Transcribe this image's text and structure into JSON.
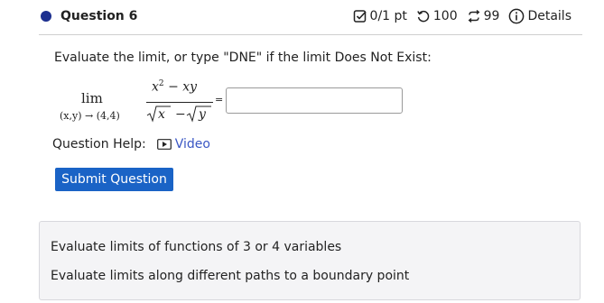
{
  "question": {
    "title": "Question 6",
    "score": "0/1 pt",
    "retries": "100",
    "attempts": "99",
    "details_label": "Details",
    "accent_color": "#1c2f8f"
  },
  "prompt": "Evaluate the limit, or type \"DNE\" if the limit Does Not Exist:",
  "math": {
    "lim": "lim",
    "subscript": "(x,y) → (4,4)",
    "numerator_main": "x",
    "numerator_exp": "2",
    "numerator_rest": " − xy",
    "denominator": "√x − √y",
    "equals": "="
  },
  "answer": {
    "value": "",
    "placeholder": ""
  },
  "help": {
    "label": "Question Help:",
    "video_label": "Video"
  },
  "submit_label": "Submit Question",
  "topics": [
    "Evaluate limits of functions of 3 or 4 variables",
    "Evaluate limits along different paths to a boundary point"
  ],
  "colors": {
    "submit_bg": "#1a63c6",
    "link": "#3a57c4"
  }
}
